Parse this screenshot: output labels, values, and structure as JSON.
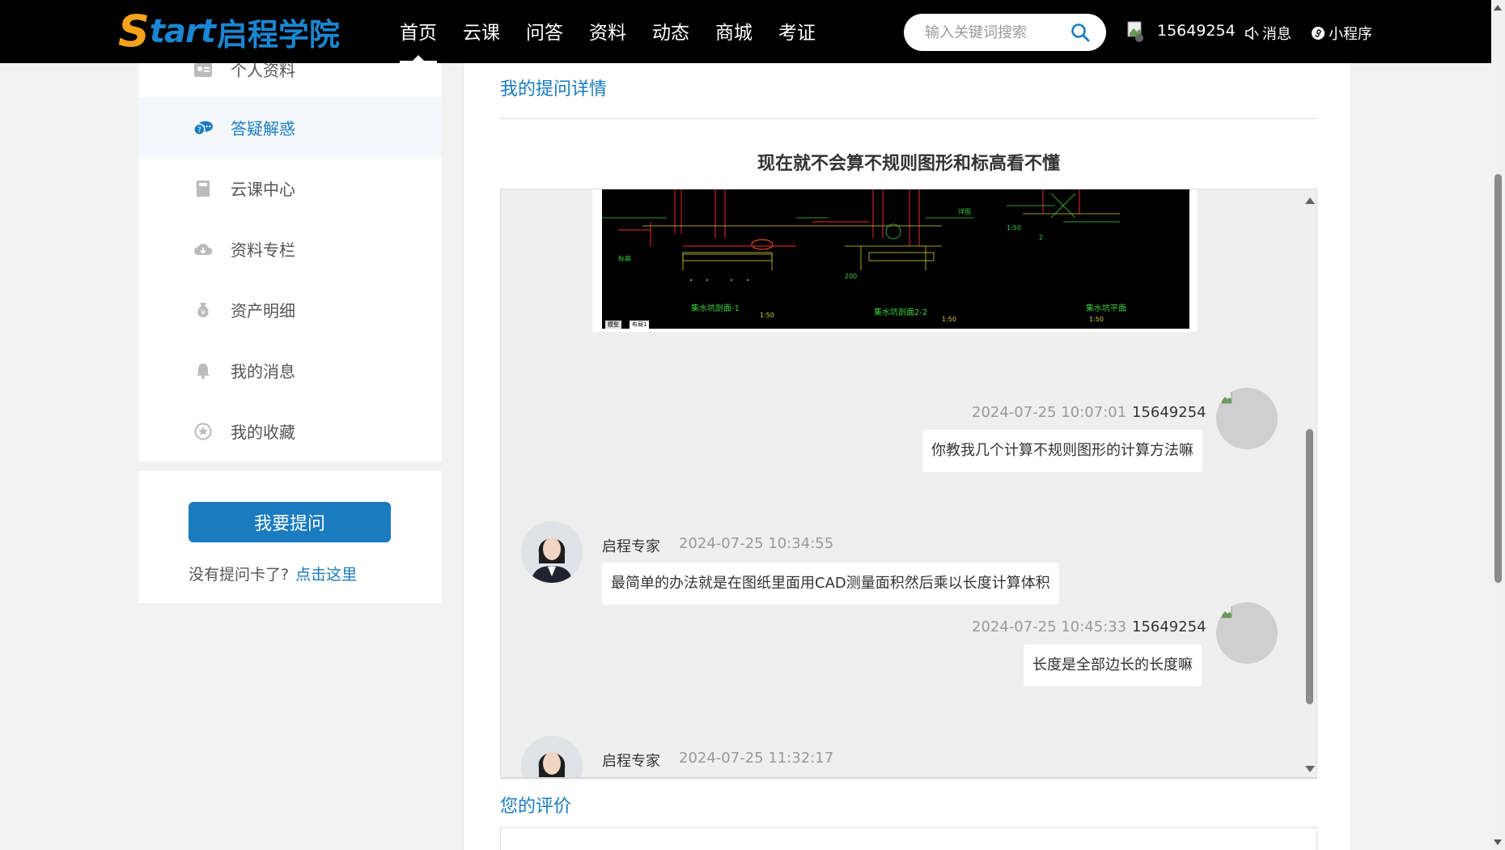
{
  "header": {
    "logo_s": "S",
    "logo_tart": "tart",
    "logo_cn": "启程学院",
    "nav": [
      "首页",
      "云课",
      "问答",
      "资料",
      "动态",
      "商城",
      "考证"
    ],
    "search_placeholder": "输入关键词搜索",
    "username": "15649254",
    "messages_label": "消息",
    "miniprogram_label": "小程序"
  },
  "sidebar": {
    "items": [
      {
        "label": "个人资料",
        "icon": "profile-card-icon"
      },
      {
        "label": "答疑解惑",
        "icon": "qa-bubble-icon"
      },
      {
        "label": "云课中心",
        "icon": "book-icon"
      },
      {
        "label": "资料专栏",
        "icon": "cloud-download-icon"
      },
      {
        "label": "资产明细",
        "icon": "money-bag-icon"
      },
      {
        "label": "我的消息",
        "icon": "bell-icon"
      },
      {
        "label": "我的收藏",
        "icon": "star-circle-icon"
      }
    ],
    "ask_button": "我要提问",
    "no_card_text": "没有提问卡了?",
    "click_here": "点击这里"
  },
  "main": {
    "title": "我的提问详情",
    "question": "现在就不会算不规则图形和标高看不懂",
    "messages": [
      {
        "time": "2024-07-25 10:07:01",
        "user": "15649254",
        "text": "你教我几个计算不规则图形的计算方法嘛"
      },
      {
        "time": "2024-07-25 10:34:55",
        "user": "启程专家",
        "text": "最简单的办法就是在图纸里面用CAD测量面积然后乘以长度计算体积"
      },
      {
        "time": "2024-07-25 10:45:33",
        "user": "15649254",
        "text": "长度是全部边长的长度嘛"
      },
      {
        "time": "2024-07-25 11:32:17",
        "user": "启程专家",
        "text": ""
      }
    ],
    "cad_labels": [
      "集水坑剖面-1",
      "集水坑剖面2-2",
      "集水坑平面",
      "1:50",
      "1:50",
      "1:50"
    ],
    "cad_tabs": [
      "模型",
      "布局1"
    ],
    "evaluation_title": "您的评价"
  },
  "colors": {
    "accent": "#1a7bbf",
    "header_bg": "#000000",
    "logo_orange": "#f6a31b"
  }
}
